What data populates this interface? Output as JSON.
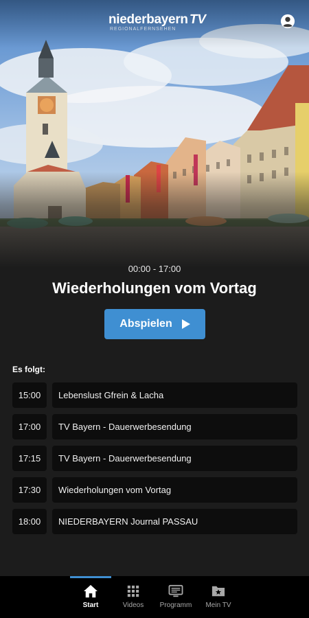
{
  "header": {
    "logo_text": "niederbayern",
    "logo_tv": "TV",
    "logo_sub": "REGIONALFERNSEHEN"
  },
  "now_playing": {
    "time_range": "00:00 - 17:00",
    "title": "Wiederholungen vom Vortag",
    "play_label": "Abspielen"
  },
  "schedule": {
    "heading": "Es folgt:",
    "items": [
      {
        "time": "15:00",
        "title": "Lebenslust Gfrein & Lacha"
      },
      {
        "time": "17:00",
        "title": "TV Bayern - Dauerwerbesendung"
      },
      {
        "time": "17:15",
        "title": "TV Bayern - Dauerwerbesendung"
      },
      {
        "time": "17:30",
        "title": "Wiederholungen vom Vortag"
      },
      {
        "time": "18:00",
        "title": "NIEDERBAYERN Journal PASSAU"
      }
    ]
  },
  "bottom_nav": {
    "items": [
      {
        "label": "Start",
        "icon": "home-icon",
        "active": true
      },
      {
        "label": "Videos",
        "icon": "grid-icon",
        "active": false
      },
      {
        "label": "Programm",
        "icon": "tv-guide-icon",
        "active": false
      },
      {
        "label": "Mein TV",
        "icon": "folder-star-icon",
        "active": false
      }
    ]
  },
  "colors": {
    "accent": "#3f8fd2",
    "background": "#1c1c1c",
    "row_background": "#0d0d0d",
    "nav_background": "#000000"
  }
}
